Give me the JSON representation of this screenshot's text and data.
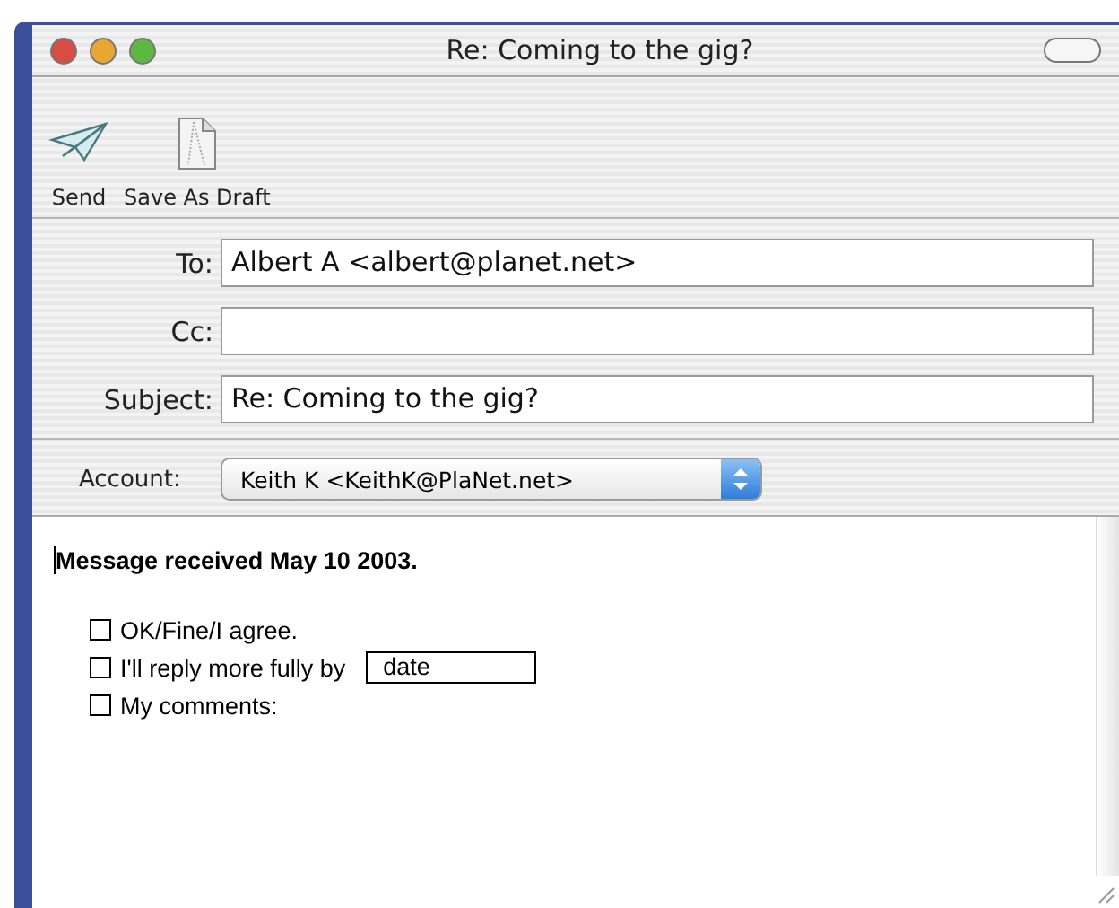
{
  "window": {
    "title": "Re: Coming to the gig?"
  },
  "toolbar": [
    {
      "kind": "send",
      "label": "Send"
    },
    {
      "kind": "draft",
      "label": "Save As Draft"
    }
  ],
  "fields": [
    {
      "label": "To:",
      "value": "Albert A <albert@planet.net>"
    },
    {
      "label": "Cc:"
    },
    {
      "label": "Subject:",
      "value": "Re: Coming to the gig?"
    }
  ],
  "account": {
    "label": "Account:",
    "value": "Keith K <KeithK@PlaNet.net>"
  },
  "body": {
    "heading": "Message received May 10 2003.",
    "options": [
      {
        "label": "OK/Fine/I agree.",
        "checked": false
      },
      {
        "label": "I'll reply more fully by",
        "checked": false,
        "field": "date"
      },
      {
        "label": "My comments:",
        "checked": false
      }
    ]
  }
}
